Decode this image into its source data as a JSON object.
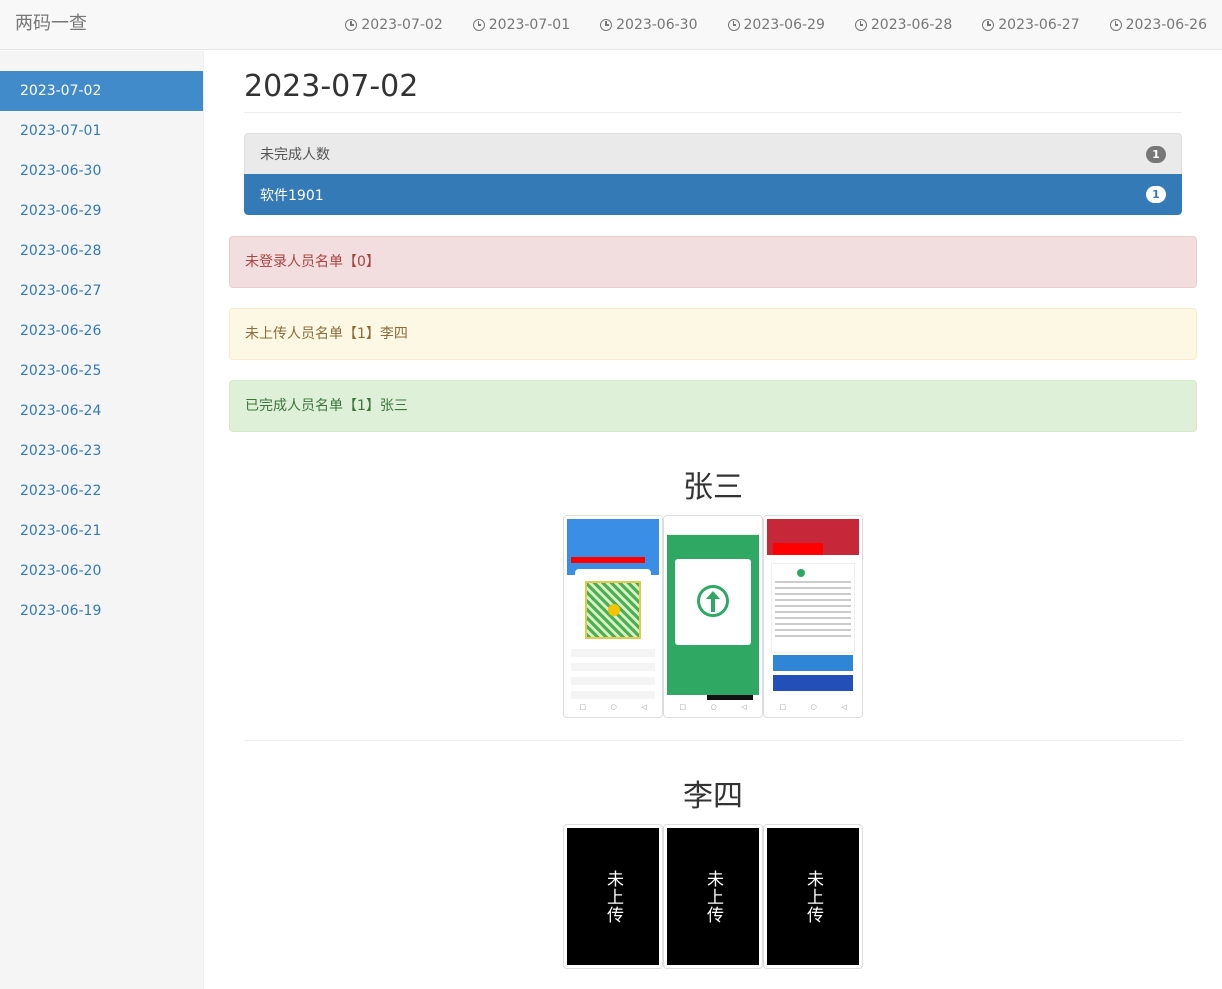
{
  "navbar": {
    "brand": "两码一查",
    "links": [
      "2023-07-02",
      "2023-07-01",
      "2023-06-30",
      "2023-06-29",
      "2023-06-28",
      "2023-06-27",
      "2023-06-26"
    ]
  },
  "sidebar": {
    "items": [
      "2023-07-02",
      "2023-07-01",
      "2023-06-30",
      "2023-06-29",
      "2023-06-28",
      "2023-06-27",
      "2023-06-26",
      "2023-06-25",
      "2023-06-24",
      "2023-06-23",
      "2023-06-22",
      "2023-06-21",
      "2023-06-20",
      "2023-06-19"
    ],
    "active": "2023-07-02"
  },
  "main": {
    "title": "2023-07-02",
    "summary": {
      "header_label": "未完成人数",
      "header_count": "1",
      "class_label": "软件1901",
      "class_count": "1"
    },
    "alerts": {
      "not_logged_in": "未登录人员名单【0】",
      "not_uploaded": "未上传人员名单【1】李四",
      "completed": "已完成人员名单【1】张三"
    },
    "people": [
      {
        "name": "张三"
      },
      {
        "name": "李四",
        "placeholder": "未上传"
      }
    ]
  },
  "icons": {
    "nav_link_icon": "clock-icon"
  }
}
